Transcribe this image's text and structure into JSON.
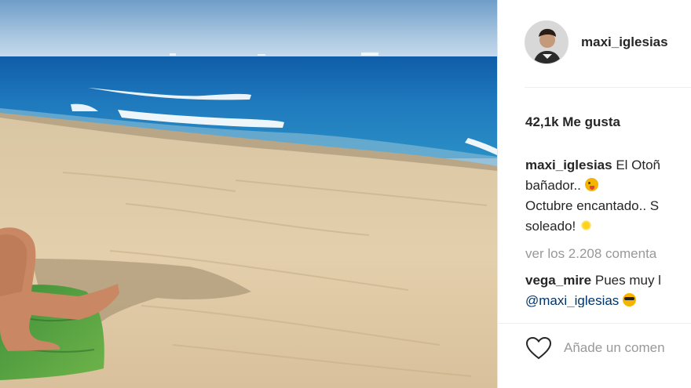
{
  "post": {
    "username": "maxi_iglesias",
    "likes": "42,1k Me gusta",
    "caption": {
      "username": "maxi_iglesias",
      "line1": "El Otoñ",
      "line2": "bañador..",
      "line3": "Octubre encantado.. S",
      "line4": "soleado!"
    },
    "view_all": "ver los 2.208 comenta",
    "comment": {
      "username": "vega_mire",
      "text": "Pues muy l",
      "mention": "@maxi_iglesias"
    },
    "add_comment_placeholder": "Añade un comen"
  },
  "icons": {
    "like": "heart-outline-icon",
    "emoji_wink": "winking-face-with-tongue-emoji",
    "emoji_sun": "sun-emoji",
    "emoji_cool": "sunglasses-face-emoji"
  },
  "colors": {
    "text": "#262626",
    "muted": "#999999",
    "link": "#003569",
    "border": "#efefef"
  }
}
